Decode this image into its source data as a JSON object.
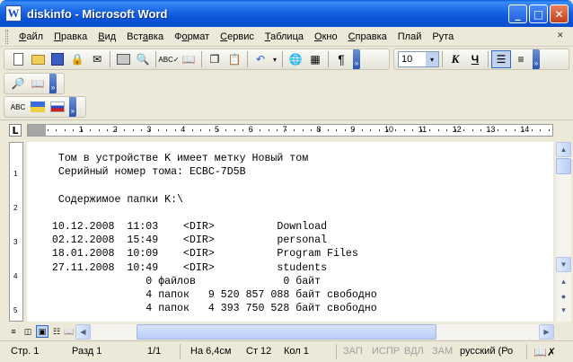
{
  "window": {
    "title": "diskinfo - Microsoft Word",
    "app_icon": "W"
  },
  "menu": [
    {
      "pre": "",
      "u": "Ф",
      "post": "айл"
    },
    {
      "pre": "",
      "u": "П",
      "post": "равка"
    },
    {
      "pre": "",
      "u": "В",
      "post": "ид"
    },
    {
      "pre": "Вст",
      "u": "а",
      "post": "вка"
    },
    {
      "pre": "Ф",
      "u": "о",
      "post": "рмат"
    },
    {
      "pre": "",
      "u": "С",
      "post": "ервис"
    },
    {
      "pre": "",
      "u": "Т",
      "post": "аблица"
    },
    {
      "pre": "",
      "u": "О",
      "post": "кно"
    },
    {
      "pre": "",
      "u": "С",
      "post": "правка"
    },
    {
      "pre": "",
      "u": "",
      "post": "Плай"
    },
    {
      "pre": "",
      "u": "",
      "post": "Рута"
    }
  ],
  "formatting": {
    "font_size": "10"
  },
  "ruler": {
    "numbers": [
      "1",
      "2",
      "3",
      "4",
      "5",
      "6",
      "7",
      "8",
      "9",
      "10",
      "11",
      "12",
      "13",
      "14"
    ]
  },
  "vruler": {
    "numbers": [
      "1",
      "2",
      "3",
      "4",
      "5"
    ]
  },
  "document": {
    "lines": [
      "   Том в устройстве K имеет метку Новый том",
      "   Серийный номер тома: ECBC-7D5B",
      "",
      "   Содержимое папки K:\\",
      "",
      "  10.12.2008  11:03    <DIR>          Download",
      "  02.12.2008  15:49    <DIR>          personal",
      "  18.01.2008  10:09    <DIR>          Program Files",
      "  27.11.2008  10:49    <DIR>          students",
      "                 0 файлов              0 байт",
      "                 4 папок   9 520 857 088 байт свободно",
      "                 4 папок   4 393 750 528 байт свободно"
    ]
  },
  "status": {
    "page": "Стр. 1",
    "section": "Разд 1",
    "pages": "1/1",
    "position": "На 6,4см",
    "line": "Ст 12",
    "column": "Кол 1",
    "rec": "ЗАП",
    "track": "ИСПР",
    "ext": "ВДЛ",
    "ovr": "ЗАМ",
    "language": "русский (Ро"
  }
}
